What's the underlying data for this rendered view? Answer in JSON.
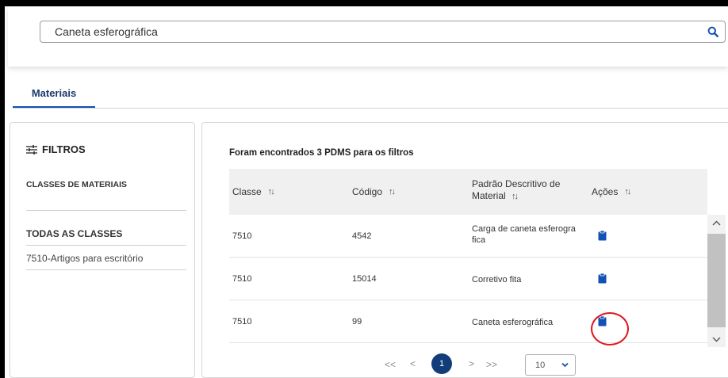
{
  "search": {
    "value": "Caneta esferográfica",
    "icon": "search-icon"
  },
  "tabs": [
    {
      "label": "Materiais",
      "active": true
    }
  ],
  "filters": {
    "title": "FILTROS",
    "icon": "filter-sliders-icon",
    "classes_heading": "CLASSES DE MATERIAIS",
    "all_classes_label": "TODAS AS CLASSES",
    "class_items": [
      "7510-Artigos para escritório"
    ]
  },
  "results": {
    "count_text": "Foram encontrados 3 PDMS para os filtros",
    "columns": [
      {
        "label": "Classe",
        "sort_icon": "⇅"
      },
      {
        "label": "Código",
        "sort_icon": "⇅"
      },
      {
        "label": "Padrão Descritivo de Material",
        "sort_icon": "⇅"
      },
      {
        "label": "Ações",
        "sort_icon": "⇅"
      }
    ],
    "sort_glyph": "↑↓",
    "rows": [
      {
        "classe": "7510",
        "codigo": "4542",
        "padrao": "Carga de caneta esferogra fica",
        "action_icon": "clipboard-icon"
      },
      {
        "classe": "7510",
        "codigo": "15014",
        "padrao": "Corretivo fita",
        "action_icon": "clipboard-icon"
      },
      {
        "classe": "7510",
        "codigo": "99",
        "padrao": "Caneta esferográfica",
        "action_icon": "clipboard-icon",
        "highlighted": true
      }
    ]
  },
  "pagination": {
    "first": "<<",
    "prev": "<",
    "current": "1",
    "next": ">",
    "last": ">>",
    "page_size": "10"
  },
  "colors": {
    "primary": "#1351b4",
    "dark_blue": "#123d7a",
    "highlight_ring": "#e0191f"
  }
}
